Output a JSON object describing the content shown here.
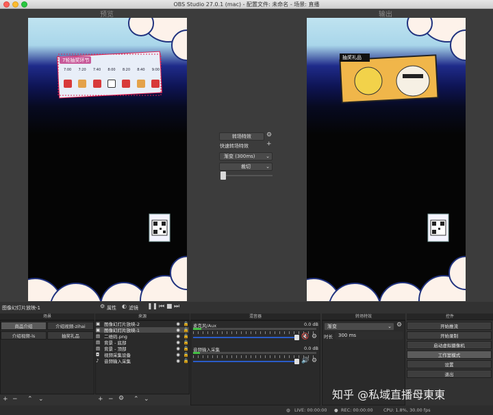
{
  "window": {
    "title": "OBS Studio 27.0.1 (mac) - 配置文件: 未命名 - 场景: 直播"
  },
  "preview": {
    "label": "预览",
    "banner_title": "7轮抽奖环节",
    "times": [
      "7:00",
      "7:20",
      "7:40",
      "8:00",
      "8:20",
      "8:40",
      "9:00"
    ]
  },
  "program": {
    "label": "输出",
    "banner_title": "抽奖礼品"
  },
  "transition_panel": {
    "transition_btn": "转场特效",
    "quick_label": "快速转场特效",
    "fade_select": "渐变 (300ms)",
    "cut_select": "裁切"
  },
  "source_toolbar": {
    "current_source": "图像幻灯片放映-1",
    "properties": "属性",
    "filters": "滤镜"
  },
  "scenes": {
    "title": "场景",
    "items": [
      "商品介绍",
      "介绍视频-zihai",
      "介绍视频-ls",
      "抽奖礼品"
    ]
  },
  "sources": {
    "title": "来源",
    "items": [
      "图像幻灯片放映-2",
      "图像幻灯片放映-1",
      "二维码.png",
      "背景 - 底部",
      "背景 - 顶部",
      "视频采集设备",
      "音频输入采集"
    ]
  },
  "mixer": {
    "title": "混音器",
    "channels": [
      {
        "name": "麦克风/Aux",
        "db": "0.0 dB",
        "scale": "-60 -55 -50 -45 -40 -35 -30 -25 -20 -15 -10 -5 0"
      },
      {
        "name": "音频输入采集",
        "db": "0.0 dB",
        "scale": "-60 -55 -50 -45 -40 -35 -30 -25 -20 -15 -10 -5 0"
      }
    ]
  },
  "transitions": {
    "title": "转场特效",
    "selected": "渐变",
    "duration_label": "时长",
    "duration_value": "300 ms"
  },
  "controls": {
    "title": "控件",
    "buttons": [
      "开始推流",
      "开始录制",
      "启动虚拟摄像机",
      "工作室模式",
      "设置",
      "退出"
    ]
  },
  "status": {
    "live": "LIVE: 00:00:00",
    "rec": "REC: 00:00:00",
    "cpu": "CPU: 1.8%, 30.00 fps"
  },
  "watermark": "知乎 @私域直播母東東",
  "colors": {
    "accent": "#2a5cc8",
    "meter": "#44c044",
    "mute": "#d03030"
  }
}
